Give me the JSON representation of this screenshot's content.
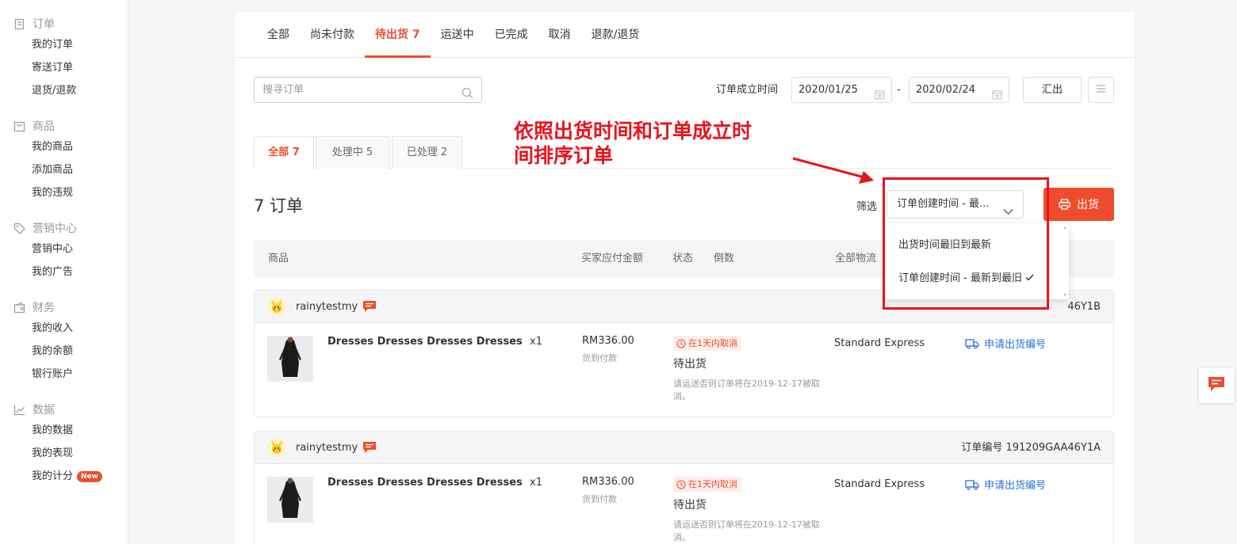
{
  "sidebar": {
    "groups": [
      {
        "title": "订单",
        "icon": "clipboard-icon",
        "items": [
          {
            "label": "我的订单"
          },
          {
            "label": "寄送订单"
          },
          {
            "label": "退货/退款"
          }
        ]
      },
      {
        "title": "商品",
        "icon": "bag-icon",
        "items": [
          {
            "label": "我的商品"
          },
          {
            "label": "添加商品"
          },
          {
            "label": "我的违规"
          }
        ]
      },
      {
        "title": "营销中心",
        "icon": "tag-icon",
        "items": [
          {
            "label": "营销中心"
          },
          {
            "label": "我的广告"
          }
        ]
      },
      {
        "title": "财务",
        "icon": "wallet-icon",
        "items": [
          {
            "label": "我的收入"
          },
          {
            "label": "我的余额"
          },
          {
            "label": "银行账户"
          }
        ]
      },
      {
        "title": "数据",
        "icon": "chart-icon",
        "items": [
          {
            "label": "我的数据"
          },
          {
            "label": "我的表现"
          },
          {
            "label": "我的计分",
            "badge": "New"
          }
        ]
      }
    ]
  },
  "tabs": [
    {
      "label": "全部"
    },
    {
      "label": "尚未付款"
    },
    {
      "label": "待出货 7",
      "active": true
    },
    {
      "label": "运送中"
    },
    {
      "label": "已完成"
    },
    {
      "label": "取消"
    },
    {
      "label": "退款/退货"
    }
  ],
  "search": {
    "placeholder": "搜寻订单"
  },
  "date_filter": {
    "label": "订单成立时间",
    "from": "2020/01/25",
    "separator": "-",
    "to": "2020/02/24"
  },
  "export_label": "汇出",
  "subtabs": [
    {
      "label": "全部 7",
      "active": true
    },
    {
      "label": "处理中 5"
    },
    {
      "label": "已处理 2"
    }
  ],
  "orders_count_title": "7 订单",
  "sort": {
    "label": "筛选",
    "selected": "订单创建时间 - 最...",
    "options": [
      {
        "label": "出货时间最旧到最新",
        "checked": false
      },
      {
        "label": "订单创建时间 - 最新到最旧",
        "checked": true
      }
    ]
  },
  "ship_button": "出货",
  "table_headers": {
    "product": "商品",
    "amount": "买家应付金额",
    "status": "状态",
    "countdown": "倒数",
    "logistics": "全部物流"
  },
  "orders": [
    {
      "buyer": "rainytestmy",
      "order_no": "订单编号 191209GAA46Y1B",
      "order_no_visible": "46Y1B",
      "product": "Dresses Dresses Dresses Dresses",
      "qty": "x1",
      "price": "RM336.00",
      "payment": "货到付款",
      "cancel_badge": "在1天内取消",
      "status": "待出货",
      "note": "请运送否则订单将在2019-12-17被取消。",
      "courier": "Standard Express",
      "action": "申请出货编号"
    },
    {
      "buyer": "rainytestmy",
      "order_no": "订单编号 191209GAA46Y1A",
      "product": "Dresses Dresses Dresses Dresses",
      "qty": "x1",
      "price": "RM336.00",
      "payment": "货到付款",
      "cancel_badge": "在1天内取消",
      "status": "待出货",
      "note": "请运送否则订单将在2019-12-17被取消。",
      "courier": "Standard Express",
      "action": "申请出货编号"
    }
  ],
  "annotation": {
    "line1": "依照出货时间和订单成立时",
    "line2": "间排序订单",
    "color": "#e8141c"
  },
  "colors": {
    "accent": "#ee4d2d",
    "link": "#2673dd"
  }
}
